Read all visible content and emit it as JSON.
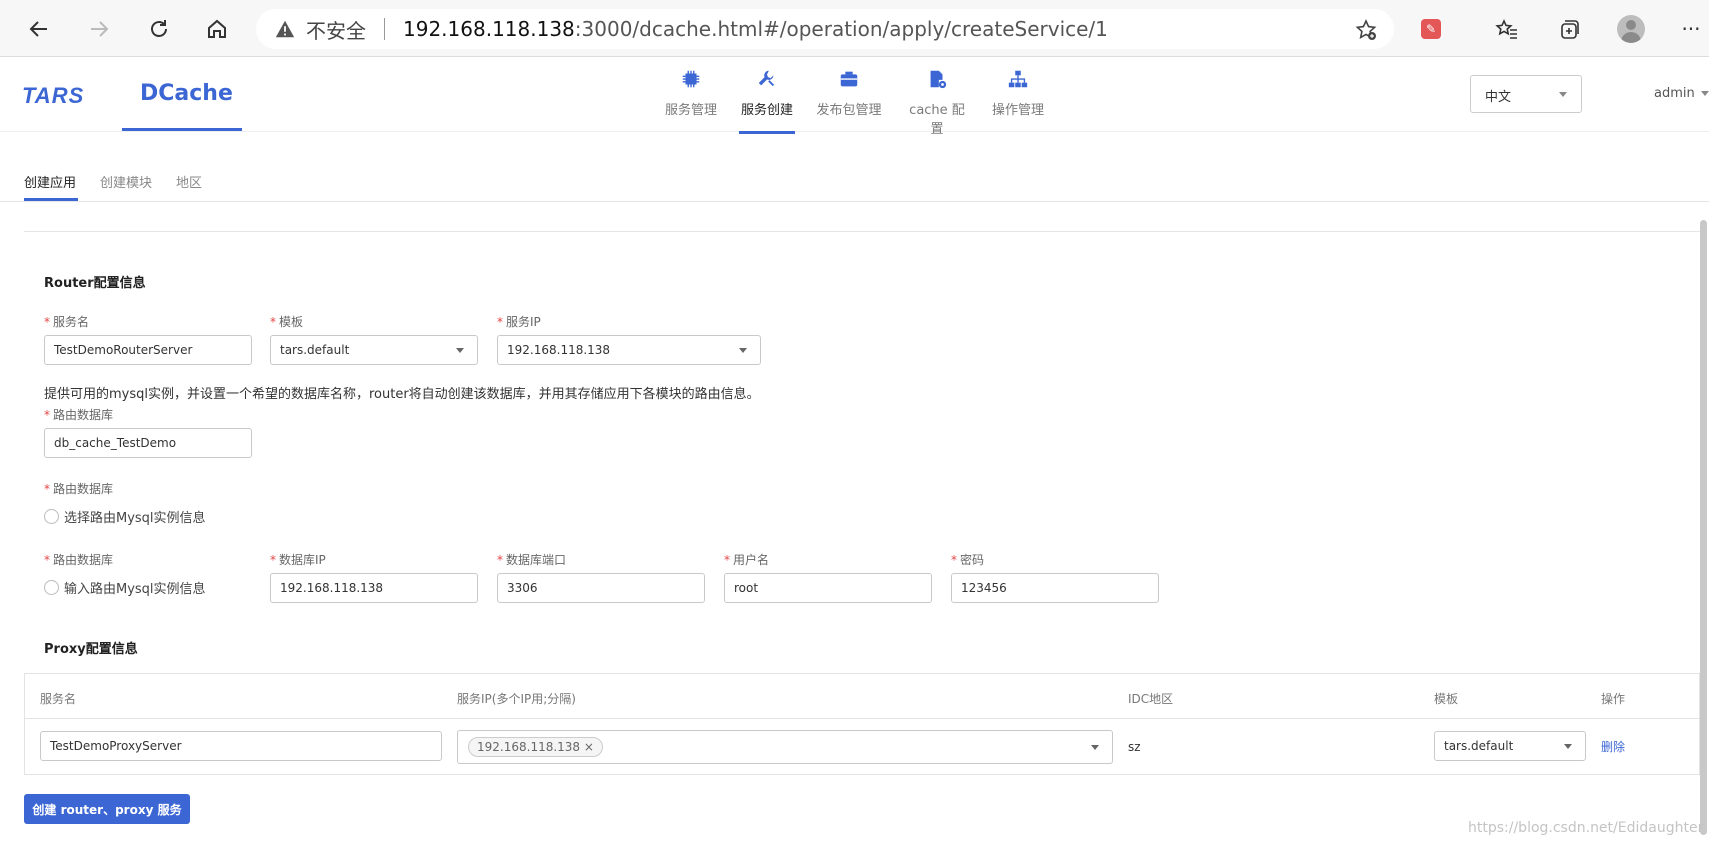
{
  "browser": {
    "insecure_label": "不安全",
    "url_host": "192.168.118.138",
    "url_rest": ":3000/dcache.html#/operation/apply/createService/1"
  },
  "header": {
    "logo_tars": "TARS",
    "logo_dcache": "DCache",
    "nav": [
      {
        "label": "服务管理",
        "icon": "chip-icon"
      },
      {
        "label": "服务创建",
        "icon": "wrench-icon",
        "active": true
      },
      {
        "label": "发布包管理",
        "icon": "package-icon"
      },
      {
        "label": "cache 配置",
        "icon": "config-file-icon"
      },
      {
        "label": "操作管理",
        "icon": "sitemap-icon"
      }
    ],
    "language": "中文",
    "user": "admin"
  },
  "subtabs": [
    {
      "label": "创建应用",
      "active": true
    },
    {
      "label": "创建模块"
    },
    {
      "label": "地区"
    }
  ],
  "router": {
    "section_title": "Router配置信息",
    "server_name_label": "服务名",
    "server_name_value": "TestDemoRouterServer",
    "template_label": "模板",
    "template_value": "tars.default",
    "service_ip_label": "服务IP",
    "service_ip_value": "192.168.118.138",
    "hint": "提供可用的mysql实例，并设置一个希望的数据库名称，router将自动创建该数据库，并用其存储应用下各模块的路由信息。",
    "db_label": "路由数据库",
    "db_value": "db_cache_TestDemo",
    "db_label_2": "路由数据库",
    "radio_select": "选择路由Mysql实例信息",
    "db_label_3": "路由数据库",
    "radio_input": "输入路由Mysql实例信息",
    "db_ip_label": "数据库IP",
    "db_ip_value": "192.168.118.138",
    "db_port_label": "数据库端口",
    "db_port_value": "3306",
    "db_user_label": "用户名",
    "db_user_value": "root",
    "db_pass_label": "密码",
    "db_pass_value": "123456"
  },
  "proxy": {
    "section_title": "Proxy配置信息",
    "columns": [
      "服务名",
      "服务IP(多个IP用;分隔)",
      "IDC地区",
      "模板",
      "操作"
    ],
    "row": {
      "server_name": "TestDemoProxyServer",
      "ip_tag": "192.168.118.138",
      "tag_close": "×",
      "idc": "sz",
      "template": "tars.default",
      "action": "删除"
    }
  },
  "submit_label": "创建 router、proxy 服务",
  "watermark": "https://blog.csdn.net/Edidaughter",
  "colors": {
    "accent": "#3b66d3",
    "required": "#e54545"
  }
}
